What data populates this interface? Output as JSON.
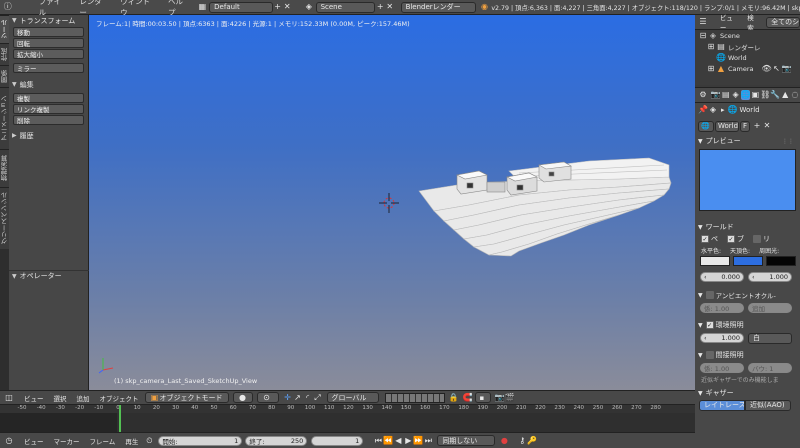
{
  "menu": {
    "items": [
      "ファイル",
      "レンダー",
      "ウィンドウ",
      "ヘルプ"
    ],
    "layout": "Default",
    "scene": "Scene",
    "engine": "Blenderレンダー",
    "stats": "v2.79 | 頂点:6,363 | 面:4,227 | 三角面:4,227 | オブジェクト:118/120 | ランプ:0/1 | メモリ:96.42M | skp_cam"
  },
  "toolshelf": {
    "tabs": [
      "ツール",
      "作成",
      "関係",
      "アニメーション",
      "物理演算",
      "グリースペンシル"
    ],
    "transform_header": "トランスフォーム",
    "transform_buttons": [
      "移動",
      "回転",
      "拡大縮小",
      "ミラー"
    ],
    "edit_header": "編集",
    "edit_buttons": [
      "複製",
      "リンク複製",
      "削除"
    ],
    "history_header": "履歴",
    "operator_header": "オペレーター"
  },
  "viewport": {
    "info": "フレーム:1| 時間:00:03.50 | 頂点:6363 | 面:4226 | 光源:1 | メモリ:152.33M (0.00M, ピーク:157.46M)",
    "object_name": "(1) skp_camera_Last_Saved_SketchUp_View"
  },
  "view_header": {
    "view": "ビュー",
    "select": "選択",
    "add": "追加",
    "object": "オブジェクト",
    "mode": "オブジェクトモード",
    "orientation": "グローバル"
  },
  "timeline": {
    "ticks": [
      "-50",
      "-40",
      "-30",
      "-20",
      "-10",
      "0",
      "10",
      "20",
      "30",
      "40",
      "50",
      "60",
      "70",
      "80",
      "90",
      "100",
      "110",
      "120",
      "130",
      "140",
      "150",
      "160",
      "170",
      "180",
      "190",
      "200",
      "210",
      "220",
      "230",
      "240",
      "250",
      "260",
      "270",
      "280"
    ],
    "current_frame": 1,
    "start_label": "開始:",
    "start": "1",
    "end_label": "終了:",
    "end": "250",
    "frame": "1",
    "menu_view": "ビュー",
    "menu_marker": "マーカー",
    "menu_frame": "フレーム",
    "menu_play": "再生",
    "sync": "同期しない"
  },
  "outliner": {
    "header_view": "ビュー",
    "header_search": "検索",
    "header_all": "全てのシ",
    "items": [
      "Scene",
      "レンダーレ",
      "World",
      "Camera"
    ]
  },
  "properties": {
    "context": "World",
    "world_field": "World",
    "world_field_f": "F",
    "preview_header": "プレビュー",
    "preview_color": "#4a8ef0",
    "world_header": "ワールド",
    "world_checks": [
      "ペ",
      "ブ",
      "リ"
    ],
    "color_labels": [
      "水平色:",
      "天頂色:",
      "周囲光:"
    ],
    "horizon_color": "#e8e8e8",
    "zenith_color": "#2d6ee0",
    "ambient_color": "#050505",
    "exposure_value": "0.000",
    "range_value": "1.000",
    "ao_header": "アンビエントオクル-",
    "ao_factor": "係: 1.00",
    "ao_blend": "追加",
    "env_header": "環境照明",
    "env_energy": "1.000",
    "env_color": "白",
    "indirect_header": "間接照明",
    "indirect_factor": "係: 1.00",
    "indirect_bounce": "バウ: 1",
    "note": "近似ギャザーでのみ機能しま",
    "gather_header": "ギャザー",
    "raytrace": "レイトレース",
    "aao": "近似(AAO)"
  }
}
